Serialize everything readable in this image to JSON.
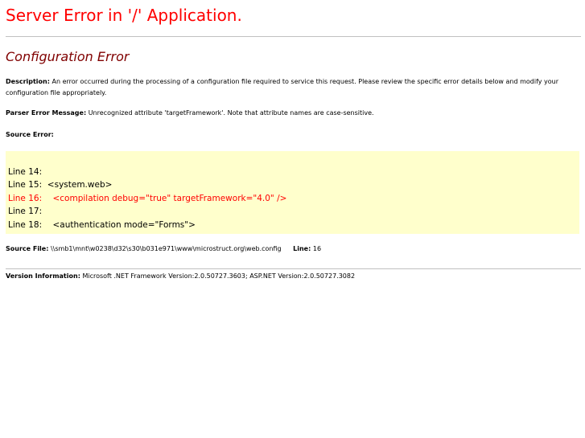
{
  "page": {
    "title": "Server Error in '/' Application."
  },
  "error": {
    "heading": "Configuration Error",
    "description_label": "Description:",
    "description_text": "An error occurred during the processing of a configuration file required to service this request. Please review the specific error details below and modify your configuration file appropriately.",
    "parser_label": "Parser Error Message:",
    "parser_text": "Unrecognized attribute 'targetFramework'. Note that attribute names are case-sensitive.",
    "source_error_label": "Source Error:"
  },
  "source_code": {
    "lines": [
      {
        "number": "Line 14:",
        "code": "",
        "highlighted": false
      },
      {
        "number": "Line 15:",
        "code": "  <system.web>",
        "highlighted": false
      },
      {
        "number": "Line 16:",
        "code": "    <compilation debug=\"true\" targetFramework=\"4.0\" />",
        "highlighted": true
      },
      {
        "number": "Line 17:",
        "code": "",
        "highlighted": false
      },
      {
        "number": "Line 18:",
        "code": "    <authentication mode=\"Forms\">",
        "highlighted": false
      }
    ]
  },
  "source_file": {
    "label": "Source File:",
    "path": "\\\\smb1\\mnt\\w0238\\d32\\s30\\b031e971\\www\\microstruct.org\\web.config",
    "line_label": "Line:",
    "line_value": "16"
  },
  "version": {
    "label": "Version Information:",
    "text": "Microsoft .NET Framework Version:2.0.50727.3603; ASP.NET Version:2.0.50727.3082"
  },
  "colors": {
    "title": "#ff0000",
    "heading": "#800000",
    "code_background": "#ffffcc",
    "highlight_line": "#ff0000",
    "rule": "#c0c0c0"
  }
}
